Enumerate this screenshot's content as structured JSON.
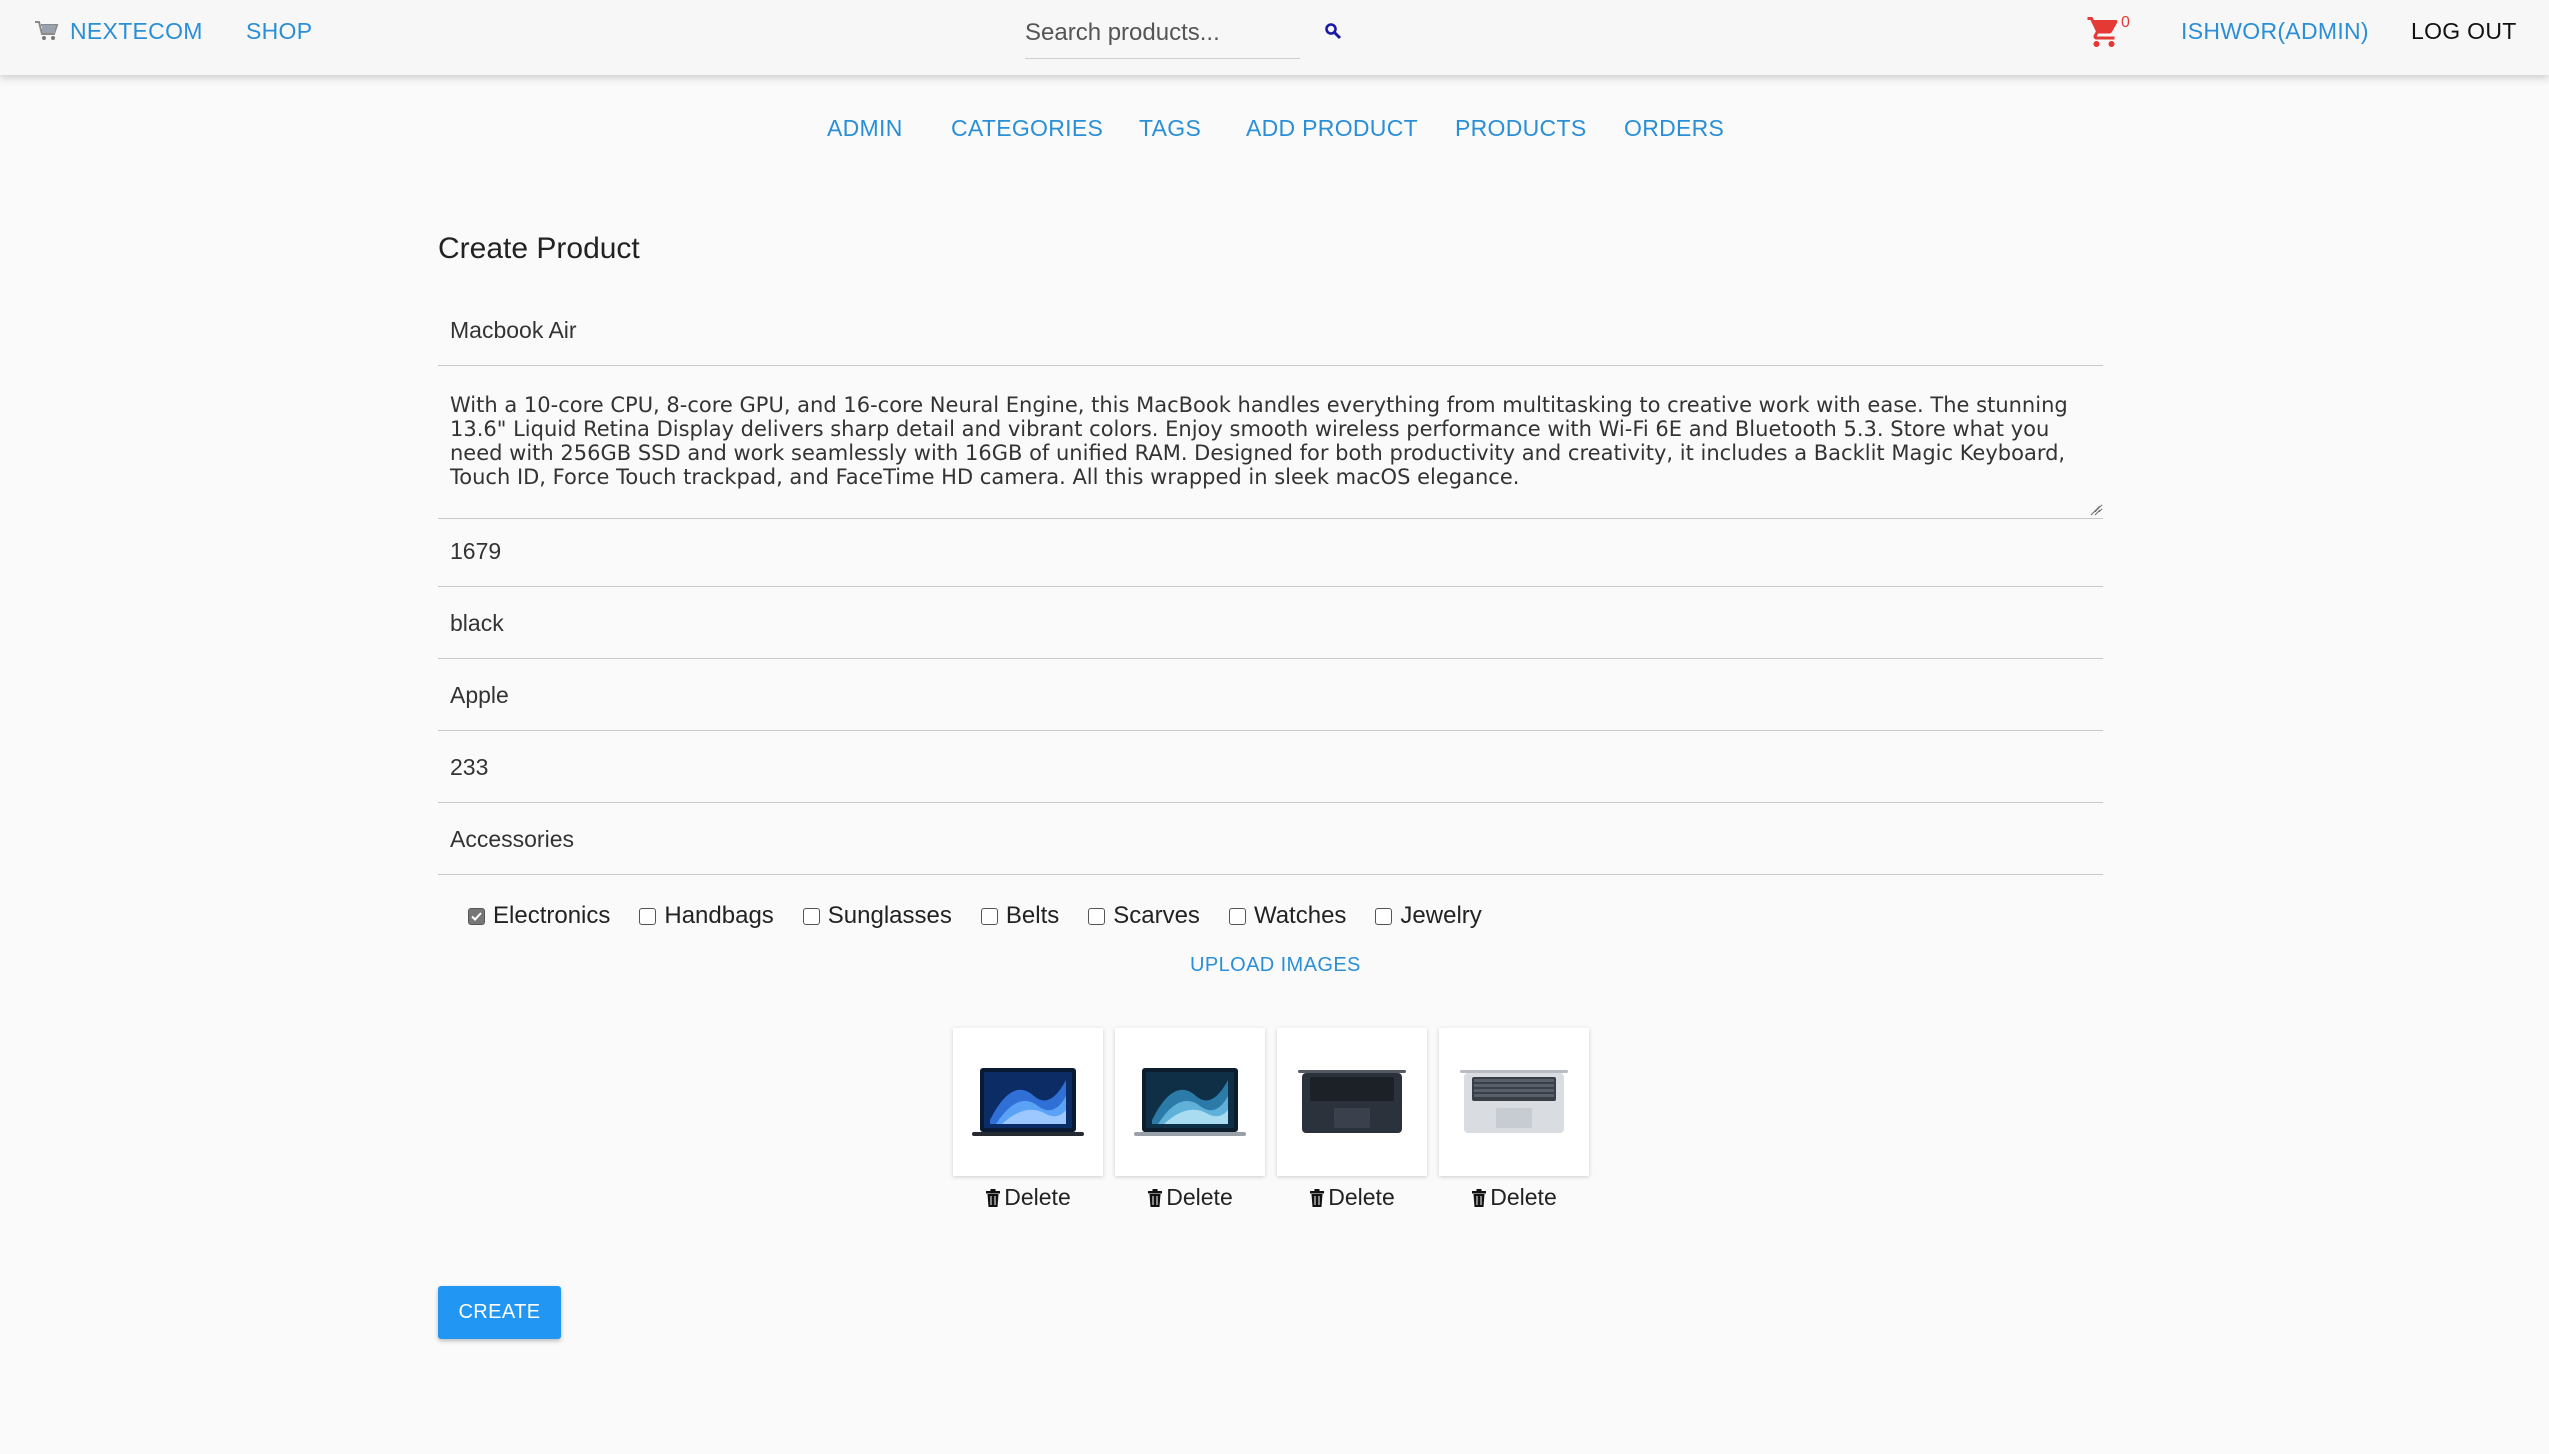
{
  "navbar": {
    "brand": "NEXTECOM",
    "shop": "SHOP",
    "search_placeholder": "Search products...",
    "cart_count": "0",
    "user": "ISHWOR(ADMIN)",
    "logout": "LOG OUT"
  },
  "admin_nav": [
    "ADMIN",
    "CATEGORIES",
    "TAGS",
    "ADD PRODUCT",
    "PRODUCTS",
    "ORDERS"
  ],
  "form": {
    "title": "Create Product",
    "name": "Macbook Air",
    "description": "With a 10-core CPU, 8-core GPU, and 16-core Neural Engine, this MacBook handles everything from multitasking to creative work with ease. The stunning 13.6\" Liquid Retina Display delivers sharp detail and vibrant colors. Enjoy smooth wireless performance with Wi-Fi 6E and Bluetooth 5.3. Store what you need with 256GB SSD and work seamlessly with 16GB of unified RAM. Designed for both productivity and creativity, it includes a Backlit Magic Keyboard, Touch ID, Force Touch trackpad, and FaceTime HD camera. All this wrapped in sleek macOS elegance.",
    "price": "1679",
    "color": "black",
    "brand": "Apple",
    "stock": "233",
    "category": "Accessories",
    "tags": [
      {
        "label": "Electronics",
        "checked": true
      },
      {
        "label": "Handbags",
        "checked": false
      },
      {
        "label": "Sunglasses",
        "checked": false
      },
      {
        "label": "Belts",
        "checked": false
      },
      {
        "label": "Scarves",
        "checked": false
      },
      {
        "label": "Watches",
        "checked": false
      },
      {
        "label": "Jewelry",
        "checked": false
      }
    ],
    "upload_label": "UPLOAD IMAGES",
    "images": [
      {
        "variant": "macbook-open-blue-wallpaper",
        "delete_label": "Delete"
      },
      {
        "variant": "macbook-open-teal-wallpaper",
        "delete_label": "Delete"
      },
      {
        "variant": "macbook-keyboard-midnight",
        "delete_label": "Delete"
      },
      {
        "variant": "macbook-keyboard-silver",
        "delete_label": "Delete"
      }
    ],
    "submit_label": "CREATE"
  },
  "colors": {
    "accent": "#2a8fd6",
    "button": "#2196f3",
    "cart": "#e53935",
    "background": "#fafafa"
  }
}
